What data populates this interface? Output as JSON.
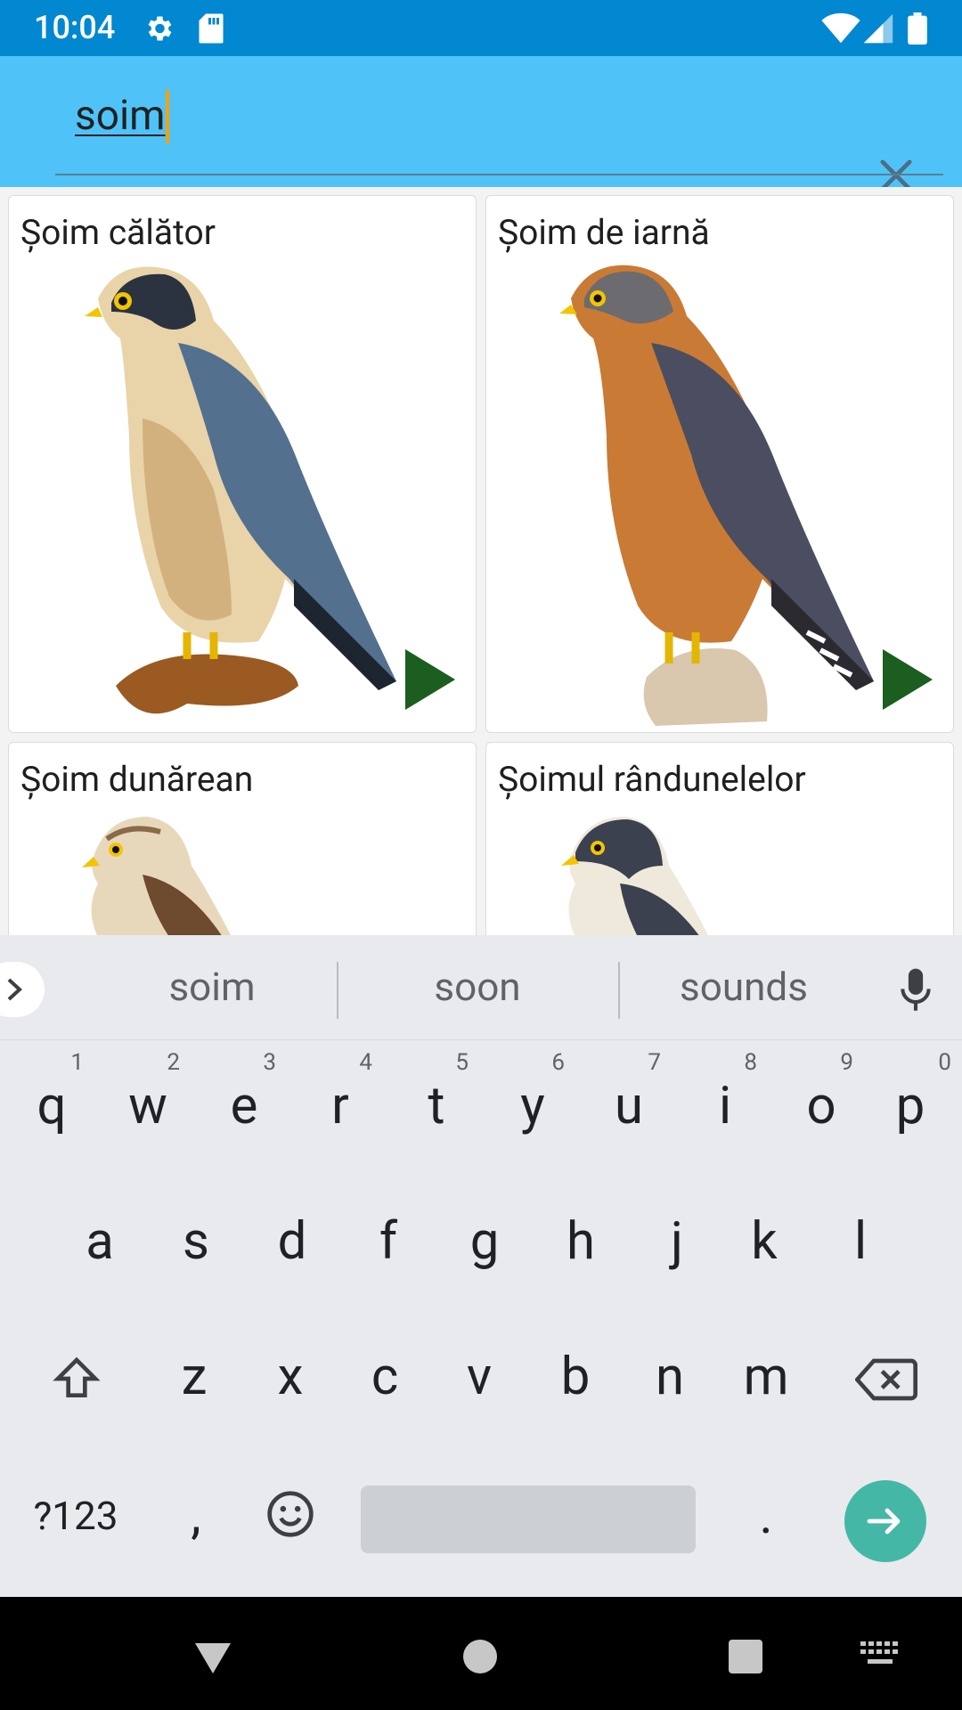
{
  "status_bar": {
    "time": "10:04",
    "icons": [
      "settings-icon",
      "sd-card-icon",
      "wifi-icon",
      "signal-icon",
      "battery-icon"
    ]
  },
  "search": {
    "value": "soim",
    "clear_icon": "close-icon"
  },
  "results": [
    {
      "name": "Șoim călător",
      "image": "peregrine-falcon",
      "play_icon": "play-icon"
    },
    {
      "name": "Șoim de iarnă",
      "image": "merlin",
      "play_icon": "play-icon"
    },
    {
      "name": "Șoim dunărean",
      "image": "saker-falcon"
    },
    {
      "name": "Șoimul rândunelelor",
      "image": "hobby"
    }
  ],
  "keyboard": {
    "suggestions": [
      "soim",
      "soon",
      "sounds"
    ],
    "row1": [
      {
        "k": "q",
        "h": "1"
      },
      {
        "k": "w",
        "h": "2"
      },
      {
        "k": "e",
        "h": "3"
      },
      {
        "k": "r",
        "h": "4"
      },
      {
        "k": "t",
        "h": "5"
      },
      {
        "k": "y",
        "h": "6"
      },
      {
        "k": "u",
        "h": "7"
      },
      {
        "k": "i",
        "h": "8"
      },
      {
        "k": "o",
        "h": "9"
      },
      {
        "k": "p",
        "h": "0"
      }
    ],
    "row2": [
      "a",
      "s",
      "d",
      "f",
      "g",
      "h",
      "j",
      "k",
      "l"
    ],
    "row3": [
      "z",
      "x",
      "c",
      "v",
      "b",
      "n",
      "m"
    ],
    "symbols_label": "?123",
    "comma": ",",
    "period": "."
  },
  "colors": {
    "status_bar": "#0288d1",
    "search_bar": "#4fc3f7",
    "play": "#1b5e20",
    "enter": "#45b7a6",
    "keyboard_bg": "#e8eaed"
  }
}
